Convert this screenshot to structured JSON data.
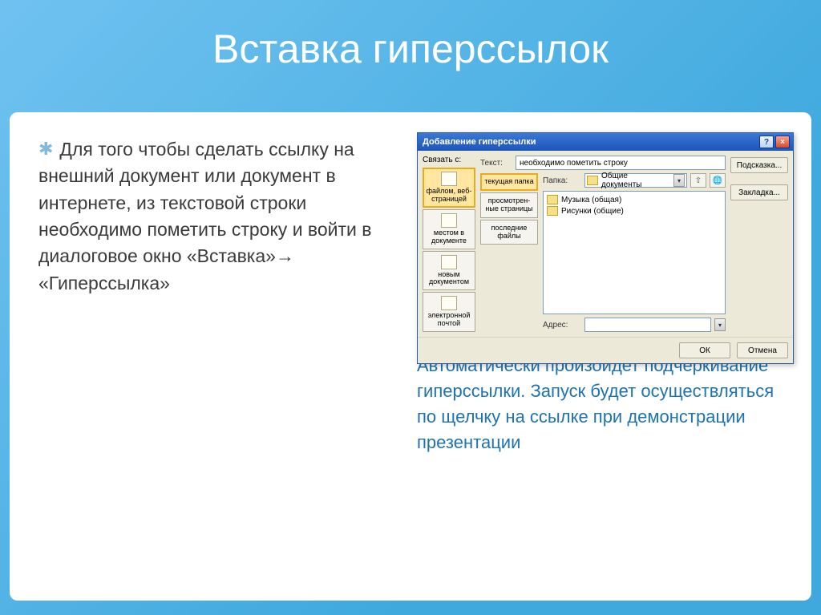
{
  "title": "Вставка гиперссылок",
  "left_text": "Для того чтобы сделать ссылку на внешний документ или документ в интернете, из текстовой строки необходимо пометить строку и войти в диалоговое окно «Вставка»→ «Гиперссылка»",
  "right_text": "Автоматически произойдет подчеркивание гиперссылки. Запуск будет осуществляться по щелчку на ссылке при демонстрации презентации",
  "dialog": {
    "title": "Добавление гиперссылки",
    "link_label": "Связать с:",
    "text_label": "Текст:",
    "text_value": "необходимо пометить строку",
    "folder_label": "Папка:",
    "folder_value": "Общие документы",
    "address_label": "Адрес:",
    "address_value": "",
    "tip_btn": "Подсказка...",
    "bookmark_btn": "Закладка...",
    "ok": "ОК",
    "cancel": "Отмена",
    "nav": [
      "файлом, веб-страницей",
      "местом в документе",
      "новым документом",
      "электронной почтой"
    ],
    "mid": [
      "текущая папка",
      "просмотрен-ные страницы",
      "последние файлы"
    ],
    "files": [
      "Музыка (общая)",
      "Рисунки (общие)"
    ]
  }
}
